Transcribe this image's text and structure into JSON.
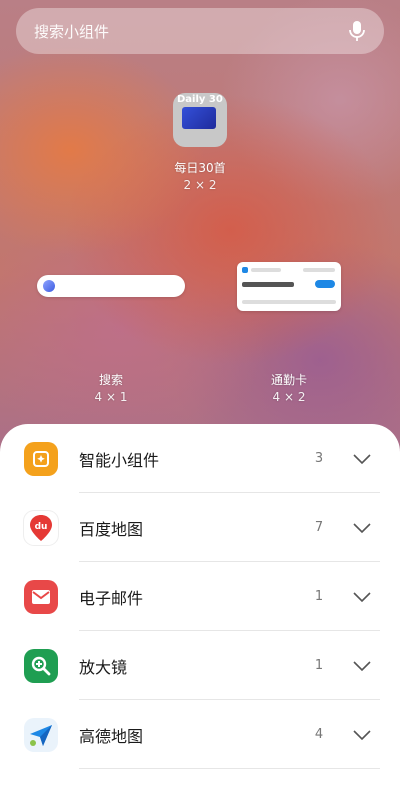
{
  "search": {
    "placeholder": "搜索小组件",
    "icon": "microphone-icon"
  },
  "widgets": [
    {
      "name": "每日30首",
      "size": "2 × 2",
      "preview_text": "Daily 30"
    },
    {
      "name": "搜索",
      "size": "4 × 1"
    },
    {
      "name": "通勤卡",
      "size": "4 × 2"
    }
  ],
  "apps": [
    {
      "name": "智能小组件",
      "count": "3",
      "icon": "smart-widget-icon",
      "color": "#f4a11c"
    },
    {
      "name": "百度地图",
      "count": "7",
      "icon": "baidu-maps-icon",
      "color": "#e53935"
    },
    {
      "name": "电子邮件",
      "count": "1",
      "icon": "email-icon",
      "color": "#e84848"
    },
    {
      "name": "放大镜",
      "count": "1",
      "icon": "magnifier-icon",
      "color": "#1f9e52"
    },
    {
      "name": "高德地图",
      "count": "4",
      "icon": "amap-icon",
      "color": "#1e88e5"
    }
  ]
}
